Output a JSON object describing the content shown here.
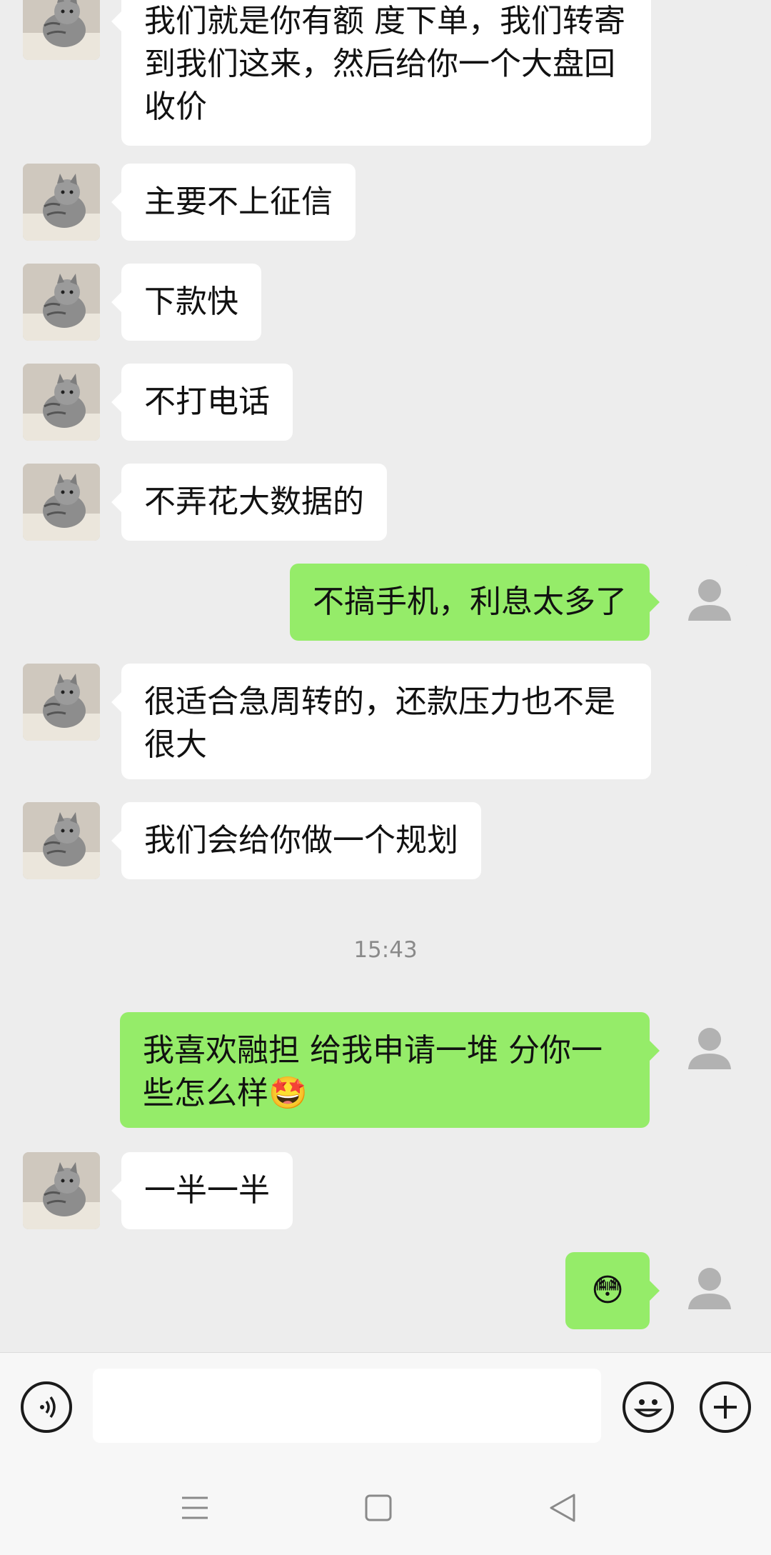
{
  "messages": [
    {
      "side": "in",
      "text": "我们就是你有额 度下单，我们转寄到我们这来，然后给你一个大盘回收价"
    },
    {
      "side": "in",
      "text": "主要不上征信"
    },
    {
      "side": "in",
      "text": "下款快"
    },
    {
      "side": "in",
      "text": "不打电话"
    },
    {
      "side": "in",
      "text": "不弄花大数据的"
    },
    {
      "side": "out",
      "text": "不搞手机，利息太多了"
    },
    {
      "side": "in",
      "text": "很适合急周转的，还款压力也不是很大"
    },
    {
      "side": "in",
      "text": "我们会给你做一个规划"
    },
    {
      "side": "out",
      "text": "我喜欢融担 给我申请一堆 分你一些怎么样🤩"
    },
    {
      "side": "in",
      "text": "一半一半"
    },
    {
      "side": "out",
      "text": "😳"
    }
  ],
  "timestamp": "15:43",
  "input": {
    "placeholder": "",
    "value": ""
  },
  "icons": {
    "voice": "voice-icon",
    "emoji": "emoji-icon",
    "plus": "plus-icon",
    "menu": "menu-icon",
    "home": "home-icon",
    "back": "back-icon"
  },
  "colors": {
    "background": "#ededed",
    "incoming_bubble": "#ffffff",
    "outgoing_bubble": "#95ec69",
    "timestamp_text": "#8a8a8a"
  }
}
